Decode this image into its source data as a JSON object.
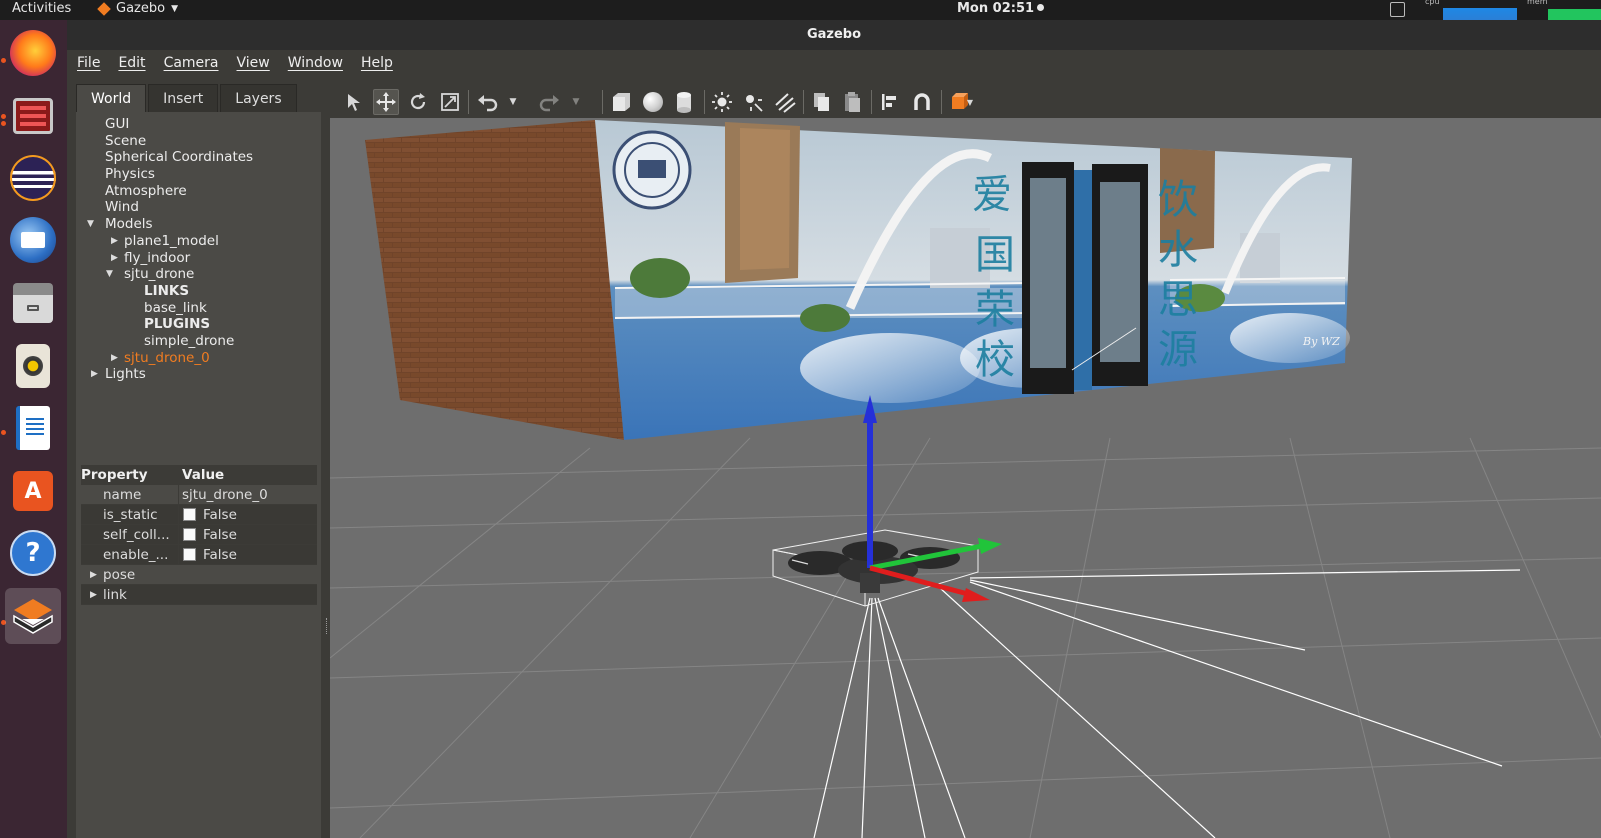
{
  "topbar": {
    "activities": "Activities",
    "app_name": "Gazebo",
    "clock": "Mon 02:51",
    "cpu_label": "cpu",
    "mem_label": "mem"
  },
  "dock": {
    "items": [
      "firefox-icon",
      "terminal-icon",
      "eclipse-icon",
      "thunderbird-icon",
      "files-icon",
      "speaker-icon",
      "writer-icon",
      "software-center-icon",
      "help-icon",
      "gazebo-icon"
    ]
  },
  "window": {
    "title": "Gazebo"
  },
  "menu": [
    "File",
    "Edit",
    "Camera",
    "View",
    "Window",
    "Help"
  ],
  "tabs": [
    "World",
    "Insert",
    "Layers"
  ],
  "tree": {
    "gui": "GUI",
    "scene": "Scene",
    "spherical": "Spherical Coordinates",
    "physics": "Physics",
    "atmosphere": "Atmosphere",
    "wind": "Wind",
    "models": "Models",
    "plane1_model": "plane1_model",
    "fly_indoor": "fly_indoor",
    "sjtu_drone": "sjtu_drone",
    "links": "LINKS",
    "base_link": "base_link",
    "plugins": "PLUGINS",
    "simple_drone": "simple_drone",
    "sjtu_drone_0": "sjtu_drone_0",
    "lights": "Lights"
  },
  "properties": {
    "header_property": "Property",
    "header_value": "Value",
    "rows": [
      {
        "key": "name",
        "value": "sjtu_drone_0"
      },
      {
        "key": "is_static",
        "value": "False"
      },
      {
        "key": "self_coll...",
        "value": "False"
      },
      {
        "key": "enable_...",
        "value": "False"
      }
    ],
    "groups": [
      "pose",
      "link"
    ]
  },
  "scene": {
    "banner_left_text": [
      "爱",
      "国",
      "荣",
      "校"
    ],
    "banner_right_text": [
      "饮",
      "水",
      "思",
      "源"
    ],
    "signature": "By WZ"
  },
  "colors": {
    "accent": "#f07c21",
    "viewport_bg": "#6e6e6e",
    "axis_x": "#e02020",
    "axis_y": "#20c020",
    "axis_z": "#2020e0"
  }
}
